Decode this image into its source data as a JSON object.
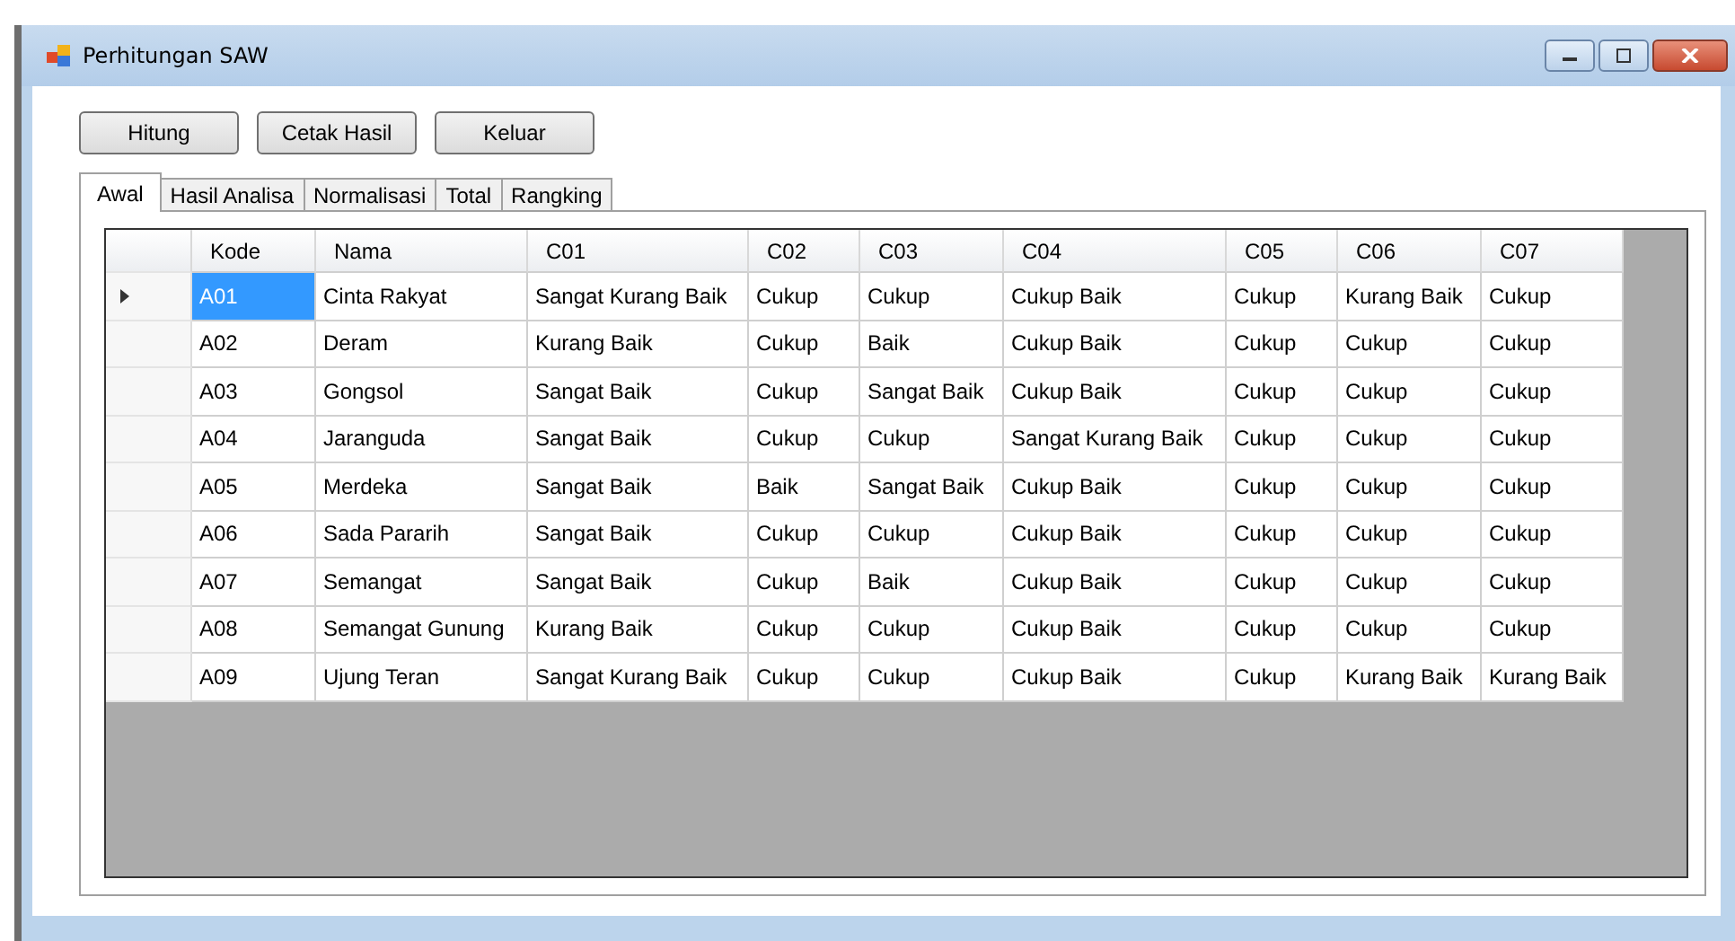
{
  "window": {
    "title": "Perhitungan SAW"
  },
  "buttons": [
    "Hitung",
    "Cetak Hasil",
    "Keluar"
  ],
  "tabs": [
    {
      "label": "Awal",
      "selected": true
    },
    {
      "label": "Hasil Analisa",
      "selected": false
    },
    {
      "label": "Normalisasi",
      "selected": false
    },
    {
      "label": "Total",
      "selected": false
    },
    {
      "label": "Rangking",
      "selected": false
    }
  ],
  "table": {
    "columns": [
      "Kode",
      "Nama",
      "C01",
      "C02",
      "C03",
      "C04",
      "C05",
      "C06",
      "C07"
    ],
    "rows": [
      {
        "selected": true,
        "cells": [
          "A01",
          "Cinta Rakyat",
          "Sangat Kurang Baik",
          "Cukup",
          "Cukup",
          "Cukup Baik",
          "Cukup",
          "Kurang Baik",
          "Cukup"
        ]
      },
      {
        "selected": false,
        "cells": [
          "A02",
          "Deram",
          "Kurang Baik",
          "Cukup",
          "Baik",
          "Cukup Baik",
          "Cukup",
          "Cukup",
          "Cukup"
        ]
      },
      {
        "selected": false,
        "cells": [
          "A03",
          "Gongsol",
          "Sangat Baik",
          "Cukup",
          "Sangat Baik",
          "Cukup Baik",
          "Cukup",
          "Cukup",
          "Cukup"
        ]
      },
      {
        "selected": false,
        "cells": [
          "A04",
          "Jaranguda",
          "Sangat Baik",
          "Cukup",
          "Cukup",
          "Sangat Kurang Baik",
          "Cukup",
          "Cukup",
          "Cukup"
        ]
      },
      {
        "selected": false,
        "cells": [
          "A05",
          "Merdeka",
          "Sangat Baik",
          "Baik",
          "Sangat Baik",
          "Cukup Baik",
          "Cukup",
          "Cukup",
          "Cukup"
        ]
      },
      {
        "selected": false,
        "cells": [
          "A06",
          "Sada Pararih",
          "Sangat Baik",
          "Cukup",
          "Cukup",
          "Cukup Baik",
          "Cukup",
          "Cukup",
          "Cukup"
        ]
      },
      {
        "selected": false,
        "cells": [
          "A07",
          "Semangat",
          "Sangat Baik",
          "Cukup",
          "Baik",
          "Cukup Baik",
          "Cukup",
          "Cukup",
          "Cukup"
        ]
      },
      {
        "selected": false,
        "cells": [
          "A08",
          "Semangat Gunung",
          "Kurang Baik",
          "Cukup",
          "Cukup",
          "Cukup Baik",
          "Cukup",
          "Cukup",
          "Cukup"
        ]
      },
      {
        "selected": false,
        "cells": [
          "A09",
          "Ujung Teran",
          "Sangat Kurang Baik",
          "Cukup",
          "Cukup",
          "Cukup Baik",
          "Cukup",
          "Kurang Baik",
          "Kurang Baik"
        ]
      }
    ]
  }
}
